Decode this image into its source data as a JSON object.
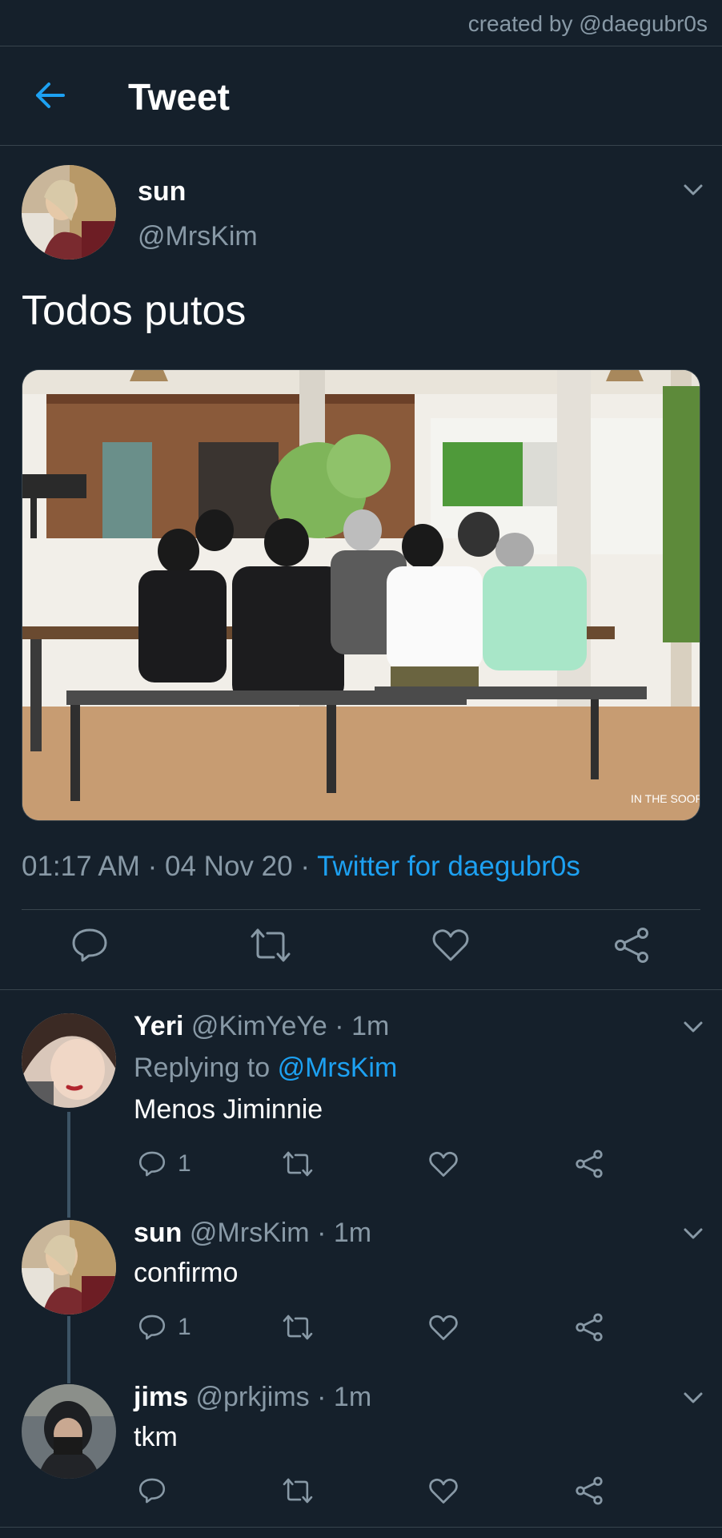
{
  "credit": "created by @daegubr0s",
  "header": {
    "title": "Tweet",
    "back_icon": "arrow-left-icon"
  },
  "colors": {
    "background": "#15202b",
    "accent": "#1da1f2",
    "muted": "#8899a6",
    "border": "#38444d"
  },
  "main_tweet": {
    "name": "sun",
    "handle": "@MrsKim",
    "text": "Todos putos",
    "media_watermark": "IN THE SOOP",
    "time": "01:17 AM",
    "date": "04 Nov 20",
    "source": "Twitter for daegubr0s",
    "sep": "·"
  },
  "replies": [
    {
      "name": "Yeri",
      "handle": "@KimYeYe",
      "age": "1m",
      "replying_prefix": "Replying to",
      "replying_to": "@MrsKim",
      "text": "Menos Jiminnie",
      "reply_count": "1"
    },
    {
      "name": "sun",
      "handle": "@MrsKim",
      "age": "1m",
      "text": "confirmo",
      "reply_count": "1"
    },
    {
      "name": "jims",
      "handle": "@prkjims",
      "age": "1m",
      "text": "tkm",
      "reply_count": ""
    }
  ]
}
